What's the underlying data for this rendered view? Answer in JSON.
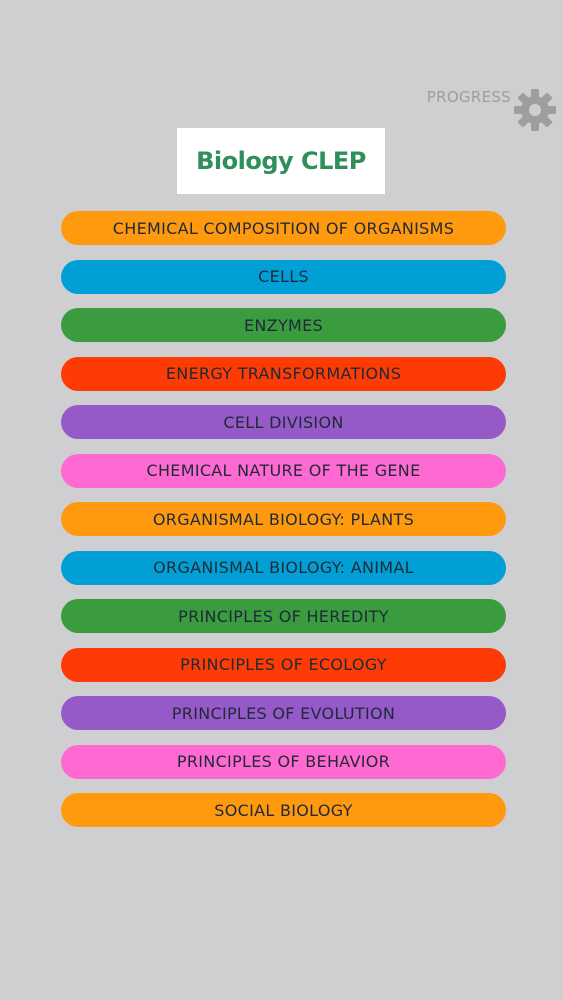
{
  "header": {
    "progress_label": "PROGRESS",
    "progress_icon": "gear-icon"
  },
  "title": "Biology CLEP",
  "colors": {
    "background": "#cfcfd1",
    "title_text": "#2f8f5b",
    "orange": "#ff9a0f",
    "blue": "#00a0d6",
    "green": "#3a9c3f",
    "red": "#ff3b05",
    "purple": "#955ac8",
    "pink": "#ff6ad2"
  },
  "topics": [
    {
      "label": "CHEMICAL COMPOSITION OF ORGANISMS",
      "color": "orange"
    },
    {
      "label": "CELLS",
      "color": "blue"
    },
    {
      "label": "ENZYMES",
      "color": "green"
    },
    {
      "label": "ENERGY TRANSFORMATIONS",
      "color": "red"
    },
    {
      "label": "CELL DIVISION",
      "color": "purple"
    },
    {
      "label": "CHEMICAL NATURE OF THE GENE",
      "color": "pink"
    },
    {
      "label": "ORGANISMAL BIOLOGY: PLANTS",
      "color": "orange"
    },
    {
      "label": "ORGANISMAL BIOLOGY: ANIMAL",
      "color": "blue"
    },
    {
      "label": "PRINCIPLES OF HEREDITY",
      "color": "green"
    },
    {
      "label": "PRINCIPLES OF ECOLOGY",
      "color": "red"
    },
    {
      "label": "PRINCIPLES OF EVOLUTION",
      "color": "purple"
    },
    {
      "label": "PRINCIPLES OF BEHAVIOR",
      "color": "pink"
    },
    {
      "label": "SOCIAL BIOLOGY",
      "color": "orange"
    }
  ]
}
